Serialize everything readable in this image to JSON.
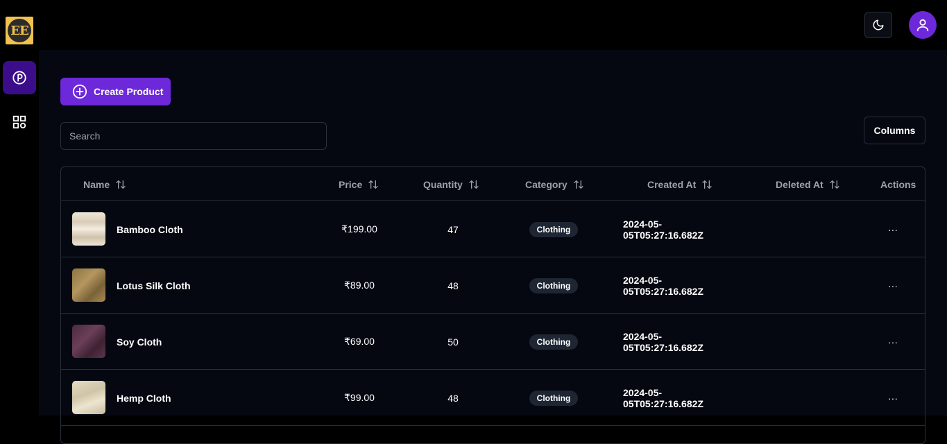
{
  "header": {
    "logo_text": "EE",
    "theme_icon": "moon-icon",
    "user_icon": "user-icon"
  },
  "sidebar": {
    "items": [
      {
        "icon": "product-p-icon",
        "active": true
      },
      {
        "icon": "grid-icon",
        "active": false
      }
    ]
  },
  "toolbar": {
    "create_label": "Create Product",
    "search_placeholder": "Search",
    "columns_label": "Columns"
  },
  "table": {
    "headers": {
      "name": "Name",
      "price": "Price",
      "quantity": "Quantity",
      "category": "Category",
      "created_at": "Created At",
      "deleted_at": "Deleted At",
      "actions": "Actions"
    },
    "rows": [
      {
        "name": "Bamboo Cloth",
        "price": "₹199.00",
        "quantity": "47",
        "category": "Clothing",
        "created_at": "2024-05-05T05:27:16.682Z",
        "deleted_at": "",
        "actions": "···"
      },
      {
        "name": "Lotus Silk Cloth",
        "price": "₹89.00",
        "quantity": "48",
        "category": "Clothing",
        "created_at": "2024-05-05T05:27:16.682Z",
        "deleted_at": "",
        "actions": "···"
      },
      {
        "name": "Soy Cloth",
        "price": "₹69.00",
        "quantity": "50",
        "category": "Clothing",
        "created_at": "2024-05-05T05:27:16.682Z",
        "deleted_at": "",
        "actions": "···"
      },
      {
        "name": "Hemp Cloth",
        "price": "₹99.00",
        "quantity": "48",
        "category": "Clothing",
        "created_at": "2024-05-05T05:27:16.682Z",
        "deleted_at": "",
        "actions": "···"
      }
    ]
  },
  "colors": {
    "accent": "#6d28d9",
    "active_sidebar": "#3b0d8a",
    "background": "#050811",
    "border": "#2a2f3a"
  }
}
